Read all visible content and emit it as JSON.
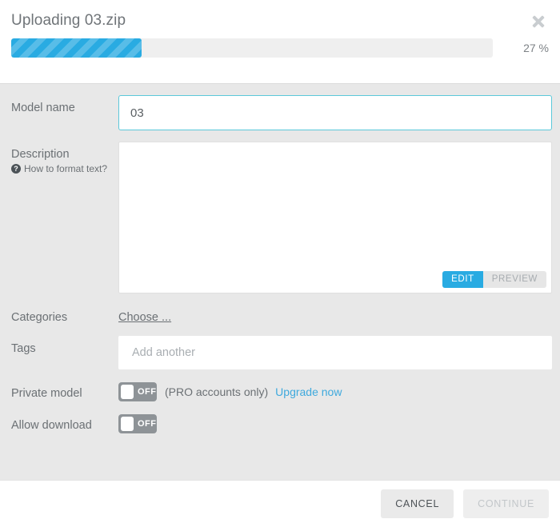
{
  "header": {
    "title": "Uploading 03.zip",
    "close_icon": "close-icon",
    "progress": {
      "percent": 27,
      "percent_label": "27 %"
    }
  },
  "form": {
    "model_name": {
      "label": "Model name",
      "value": "03",
      "placeholder": ""
    },
    "description": {
      "label": "Description",
      "help_icon": "question-circle-icon",
      "help_text": "How to format text?",
      "value": "",
      "placeholder": "",
      "mode_edit": "EDIT",
      "mode_preview": "PREVIEW"
    },
    "categories": {
      "label": "Categories",
      "choose_link": "Choose ..."
    },
    "tags": {
      "label": "Tags",
      "value": "",
      "placeholder": "Add another"
    },
    "private_model": {
      "label": "Private model",
      "state": "OFF",
      "note": "(PRO accounts only)",
      "upgrade_link": "Upgrade now"
    },
    "allow_download": {
      "label": "Allow download",
      "state": "OFF"
    }
  },
  "footer": {
    "cancel_label": "CANCEL",
    "continue_label": "CONTINUE"
  },
  "colors": {
    "accent_blue": "#29abe2",
    "link_blue": "#3ea9dd",
    "focus_border": "#5bc8da",
    "body_bg": "#e8e8e8",
    "toggle_off": "#8e9397"
  }
}
